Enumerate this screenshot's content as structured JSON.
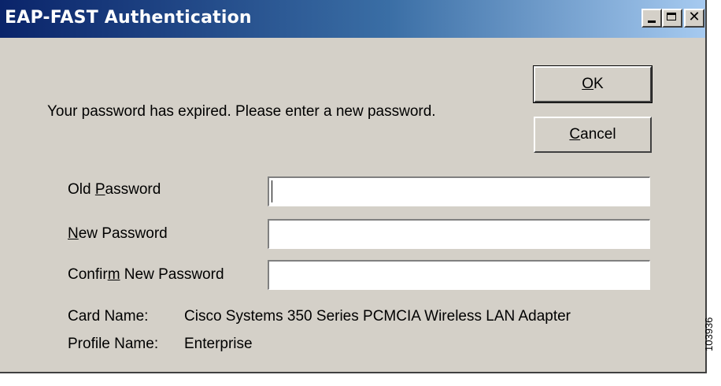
{
  "window": {
    "title": "EAP-FAST Authentication",
    "minimize_icon": "minimize-icon",
    "maximize_icon": "maximize-icon",
    "close_icon": "close-icon",
    "close_glyph": "✕"
  },
  "message": "Your password has expired.  Please enter a new password.",
  "buttons": {
    "ok": {
      "mnemonic": "O",
      "rest": "K"
    },
    "cancel": {
      "mnemonic": "C",
      "rest": "ancel"
    }
  },
  "fields": {
    "old_password": {
      "before": "Old ",
      "mnemonic": "P",
      "after": "assword",
      "value": ""
    },
    "new_password": {
      "before": "",
      "mnemonic": "N",
      "after": "ew Password",
      "value": ""
    },
    "confirm_password": {
      "before": "Confir",
      "mnemonic": "m",
      "after": " New Password",
      "value": ""
    }
  },
  "info": {
    "card_name_label": "Card Name:",
    "card_name_value": "Cisco Systems 350 Series PCMCIA Wireless LAN Adapter",
    "profile_name_label": "Profile Name:",
    "profile_name_value": "Enterprise"
  },
  "figure_code": "103936"
}
